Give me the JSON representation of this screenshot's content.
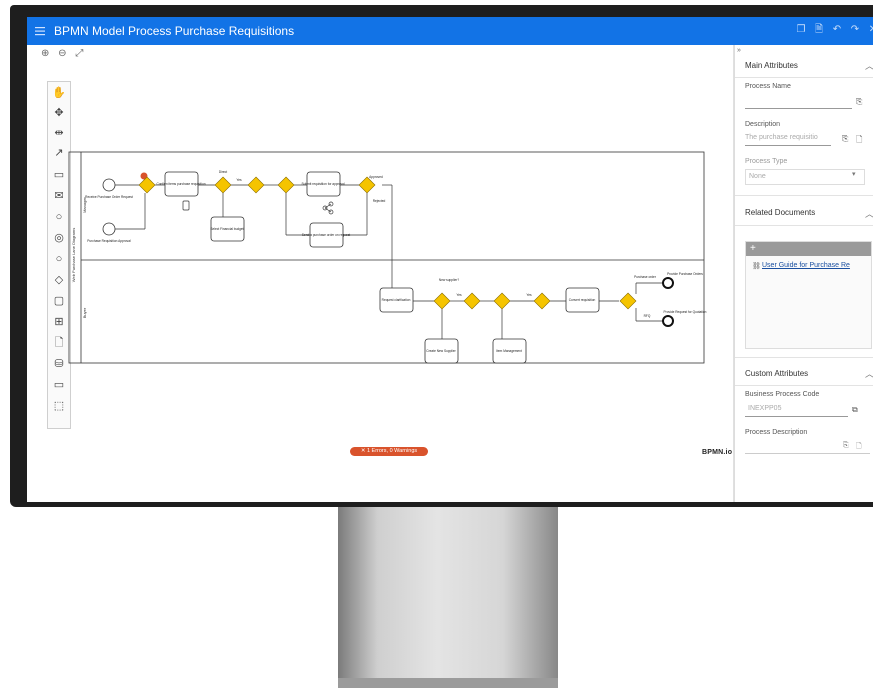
{
  "window": {
    "title": "BPMN Model Process Purchase Requisitions"
  },
  "zoom_controls": [
    "⊕",
    "⊖",
    "⤢"
  ],
  "palette_tools": [
    "hand-tool",
    "lasso-tool",
    "space-tool",
    "connect-tool",
    "pool-tool",
    "message-tool",
    "start-event-tool",
    "intermediate-event-tool",
    "end-event-tool",
    "gateway-tool",
    "task-tool",
    "subprocess-tool",
    "data-object-tool",
    "data-store-tool",
    "participant-tool",
    "group-tool"
  ],
  "diagram": {
    "lane_top": "Manager",
    "lane_bottom": "Buyer",
    "pool_label": "Web Purchase Lane Diagrams",
    "tasks": {
      "t1": "Confirm items purchase requisition",
      "t2": "Submit requisition for approval",
      "t3": "Select Financial budget",
      "t4": "Send a purchase order on request",
      "t5": "Request clarification",
      "t6": "Create New Supplier",
      "t7": "Item Management",
      "t8": "Convert requisition"
    },
    "events": {
      "s1": "Receive Purchase Order Request",
      "s2": "Purchase Requisition Approval",
      "e1": "Provide Purchase Orders",
      "e2": "Provide Request for Quotation"
    },
    "flow_labels": {
      "f1": "Direct",
      "f2": "Yes",
      "f3": "Approved",
      "f4": "Rejected",
      "f5": "New supplier?",
      "f6": "Yes",
      "f7": "Yes",
      "f8": "Purchase order",
      "f9": "RFQ"
    }
  },
  "status": {
    "errors": "✕ 1 Errors, 0 Warnings",
    "logo": "BPMN.io"
  },
  "panel": {
    "main_attributes": "Main Attributes",
    "process_name_label": "Process Name",
    "process_name_value": "",
    "description_label": "Description",
    "description_value": "The purchase requisitio",
    "process_type_label": "Process Type",
    "process_type_value": "None",
    "related_documents": "Related Documents",
    "doc_link": "User Guide for Purchase Re",
    "custom_attributes": "Custom Attributes",
    "business_process_code_label": "Business Process Code",
    "business_process_code_value": "INEXPP05",
    "process_description_label": "Process Description"
  },
  "colors": {
    "titlebar": "#1273e6",
    "gateway": "#f5c400",
    "error": "#d9532c"
  }
}
